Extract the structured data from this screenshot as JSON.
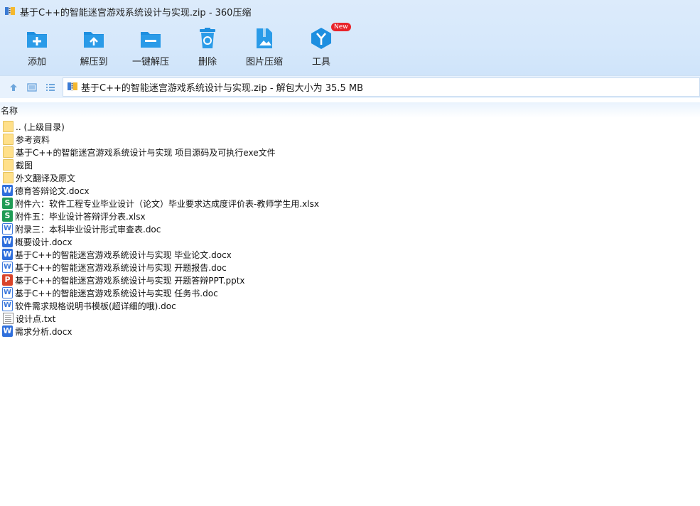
{
  "window": {
    "title": "基于C++的智能迷宫游戏系统设计与实现.zip - 360压缩"
  },
  "toolbar": {
    "items": [
      {
        "label": "添加",
        "icon": "add-icon"
      },
      {
        "label": "解压到",
        "icon": "extract-to-icon"
      },
      {
        "label": "一键解压",
        "icon": "one-click-extract-icon"
      },
      {
        "label": "删除",
        "icon": "recycle-bin-icon"
      },
      {
        "label": "图片压缩",
        "icon": "image-compress-icon"
      },
      {
        "label": "工具",
        "icon": "tools-icon",
        "badge": "New"
      }
    ]
  },
  "address": {
    "path": "基于C++的智能迷宫游戏系统设计与实现.zip - 解包大小为 35.5 MB"
  },
  "list": {
    "header_name": "名称",
    "files": [
      {
        "name": ".. (上级目录)",
        "type": "folder"
      },
      {
        "name": "参考资料",
        "type": "folder"
      },
      {
        "name": "基于C++的智能迷宫游戏系统设计与实现 项目源码及可执行exe文件",
        "type": "folder"
      },
      {
        "name": "截图",
        "type": "folder"
      },
      {
        "name": "外文翻译及原文",
        "type": "folder"
      },
      {
        "name": "德育答辩论文.docx",
        "type": "docx"
      },
      {
        "name": "附件六：软件工程专业毕业设计（论文）毕业要求达成度评价表-教师学生用.xlsx",
        "type": "xlsx"
      },
      {
        "name": "附件五：毕业设计答辩评分表.xlsx",
        "type": "xlsx"
      },
      {
        "name": "附录三：本科毕业设计形式审查表.doc",
        "type": "doc"
      },
      {
        "name": "概要设计.docx",
        "type": "docx"
      },
      {
        "name": "基于C++的智能迷宫游戏系统设计与实现 毕业论文.docx",
        "type": "docx"
      },
      {
        "name": "基于C++的智能迷宫游戏系统设计与实现 开题报告.doc",
        "type": "doc"
      },
      {
        "name": "基于C++的智能迷宫游戏系统设计与实现 开题答辩PPT.pptx",
        "type": "pptx"
      },
      {
        "name": "基于C++的智能迷宫游戏系统设计与实现 任务书.doc",
        "type": "doc"
      },
      {
        "name": "软件需求规格说明书模板(超详细的哦).doc",
        "type": "doc"
      },
      {
        "name": "设计点.txt",
        "type": "txt"
      },
      {
        "name": "需求分析.docx",
        "type": "docx"
      }
    ]
  },
  "colors": {
    "accent": "#1e8fe0",
    "toolbar_bg": "#d6e8fb",
    "badge": "#e8232a"
  }
}
